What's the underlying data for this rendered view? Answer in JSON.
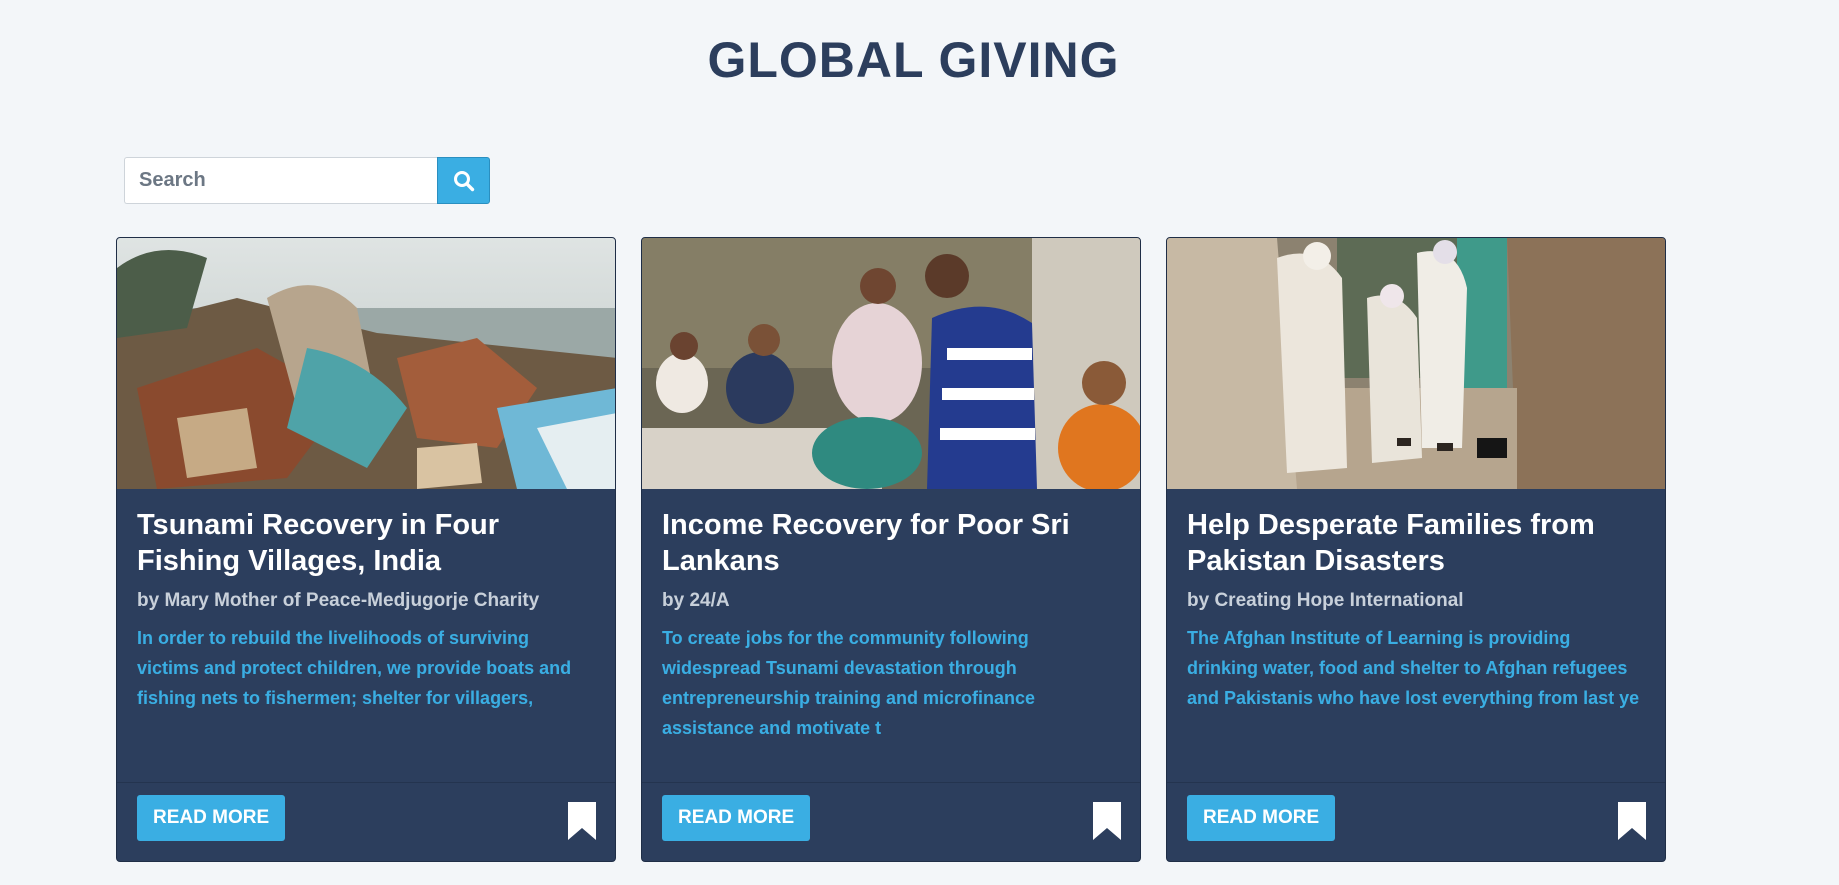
{
  "header": {
    "title": "GLOBAL GIVING"
  },
  "search": {
    "placeholder": "Search",
    "value": "",
    "button_icon": "search-icon"
  },
  "colors": {
    "background": "#f3f6f9",
    "title": "#2c3e5d",
    "card": "#2c3e5d",
    "accent": "#3aaee3",
    "author": "#c8d0da"
  },
  "projects": [
    {
      "image": "photo: man sitting on debris of fishing boats and nets by the sea",
      "title": "Tsunami Recovery in Four Fishing Villages, India",
      "author": "by Mary Mother of Peace-Medjugorje Charity",
      "description": "In order to rebuild the livelihoods of surviving victims and protect children, we provide boats and fishing nets to fishermen; shelter for villagers,",
      "button_label": "READ MORE",
      "bookmark_icon": "bookmark-icon"
    },
    {
      "image": "photo: group of men and a monk distributing fishing nets",
      "title": "Income Recovery for Poor Sri Lankans",
      "author": "by 24/A",
      "description": "To create jobs for the community following widespread Tsunami devastation through entrepreneurship training and microfinance assistance and motivate t",
      "button_label": "READ MORE",
      "bookmark_icon": "bookmark-icon"
    },
    {
      "image": "photo: elderly men walking along a mud wall",
      "title": "Help Desperate Families from Pakistan Disasters",
      "author": "by Creating Hope International",
      "description": "The Afghan Institute of Learning is providing drinking water, food and shelter to Afghan refugees and Pakistanis who have lost everything from last ye",
      "button_label": "READ MORE",
      "bookmark_icon": "bookmark-icon"
    }
  ]
}
